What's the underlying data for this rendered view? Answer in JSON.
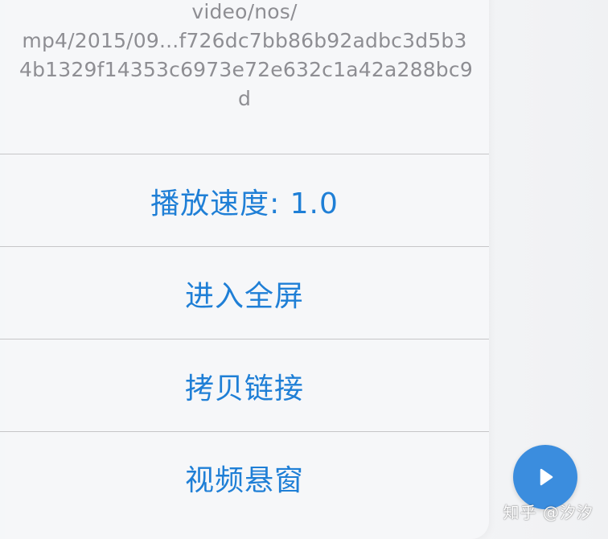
{
  "message": {
    "text": "video/nos/\nmp4/2015/09...f726dc7bb86b92adbc3d5b3\n4b1329f14353c6973e72e632c1a42a288bc9\nd"
  },
  "actions": {
    "playback_speed": "播放速度: 1.0",
    "fullscreen": "进入全屏",
    "copy_link": "拷贝链接",
    "floating_window": "视频悬窗"
  },
  "watermark": {
    "text": "知乎 @汐汐"
  },
  "colors": {
    "action_text": "#1f7fd6",
    "message_text": "#8e8e93",
    "play_button": "#3b8dde"
  },
  "icons": {
    "play": "play-icon"
  }
}
